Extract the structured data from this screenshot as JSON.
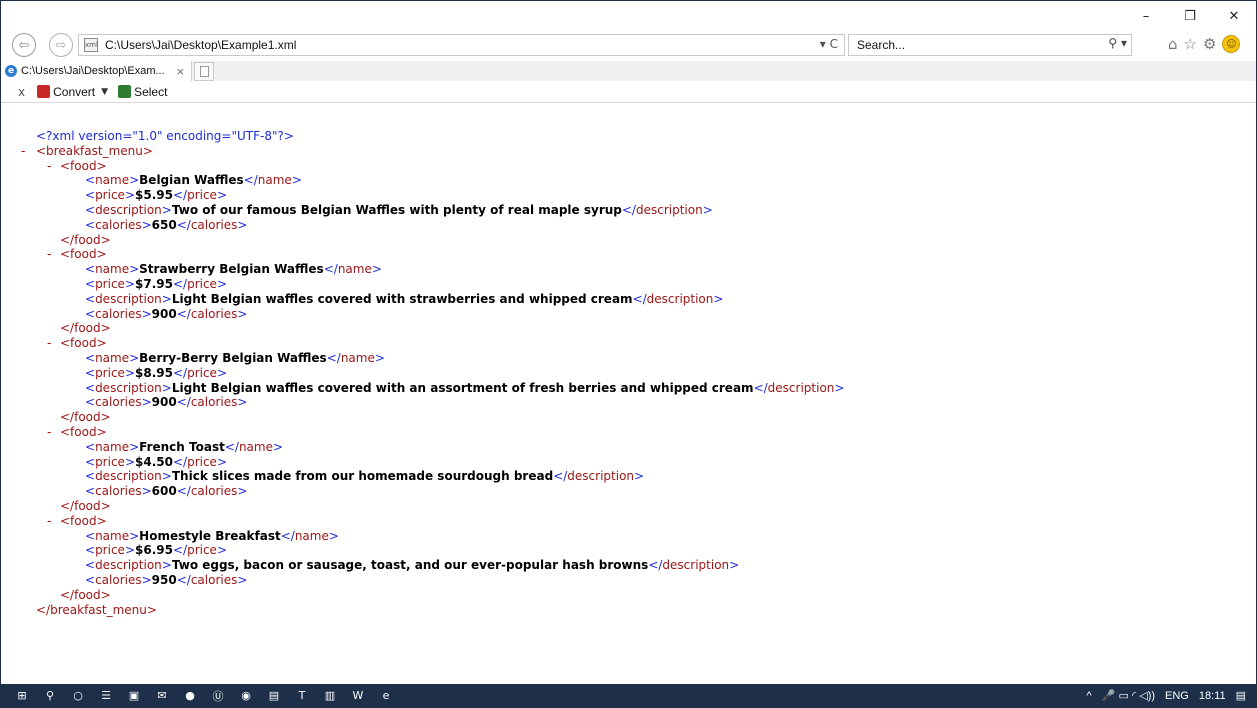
{
  "window": {
    "minimize": "–",
    "restore": "❐",
    "close": "✕"
  },
  "addressbar": {
    "back": "⇦",
    "forward": "⇨",
    "url": "C:\\Users\\Jai\\Desktop\\Example1.xml",
    "controls": "▾ C",
    "search_placeholder": "Search...",
    "search_icon": "⚲ ▾"
  },
  "toolbar_icons": {
    "home": "⌂",
    "favorites": "☆",
    "settings": "⚙",
    "smiley": "☺"
  },
  "tab": {
    "title": "C:\\Users\\Jai\\Desktop\\Exam...",
    "close": "×"
  },
  "commandbar": {
    "close": "x",
    "convert": "Convert",
    "convert_caret": "▼",
    "select": "Select"
  },
  "xml": {
    "declaration": "<?xml version=\"1.0\" encoding=\"UTF-8\"?>",
    "minus": "-",
    "root_open": "<breakfast_menu>",
    "root_close": "</breakfast_menu>",
    "food_open": "<food>",
    "food_close": "</food>",
    "items": [
      {
        "name": "Belgian Waffles",
        "price": "$5.95",
        "description": "Two of our famous Belgian Waffles with plenty of real maple syrup",
        "calories": "650"
      },
      {
        "name": "Strawberry Belgian Waffles",
        "price": "$7.95",
        "description": "Light Belgian waffles covered with strawberries and whipped cream",
        "calories": "900"
      },
      {
        "name": "Berry-Berry Belgian Waffles",
        "price": "$8.95",
        "description": "Light Belgian waffles covered with an assortment of fresh berries and whipped cream",
        "calories": "900"
      },
      {
        "name": "French Toast",
        "price": "$4.50",
        "description": "Thick slices made from our homemade sourdough bread",
        "calories": "600"
      },
      {
        "name": "Homestyle Breakfast",
        "price": "$6.95",
        "description": "Two eggs, bacon or sausage, toast, and our ever-popular hash browns",
        "calories": "950"
      }
    ]
  },
  "taskbar": {
    "icons": [
      "windows-icon",
      "search-icon",
      "cortana-icon",
      "task-view-icon",
      "store-icon",
      "mail-icon",
      "chrome-icon",
      "uipath-icon",
      "edge-icon",
      "file-explorer-icon",
      "teams-icon",
      "notes-icon",
      "word-icon",
      "internet-explorer-icon"
    ],
    "glyphs": [
      "⊞",
      "⚲",
      "○",
      "☰",
      "▣",
      "✉",
      "●",
      "Ⓤ",
      "◉",
      "▤",
      "T",
      "▥",
      "W",
      "e"
    ],
    "tray_caret": "^",
    "tray_icons": "🎤 ▭ ◜ ◁))",
    "language": "ENG",
    "time": "18:11",
    "notifications": "▤"
  }
}
